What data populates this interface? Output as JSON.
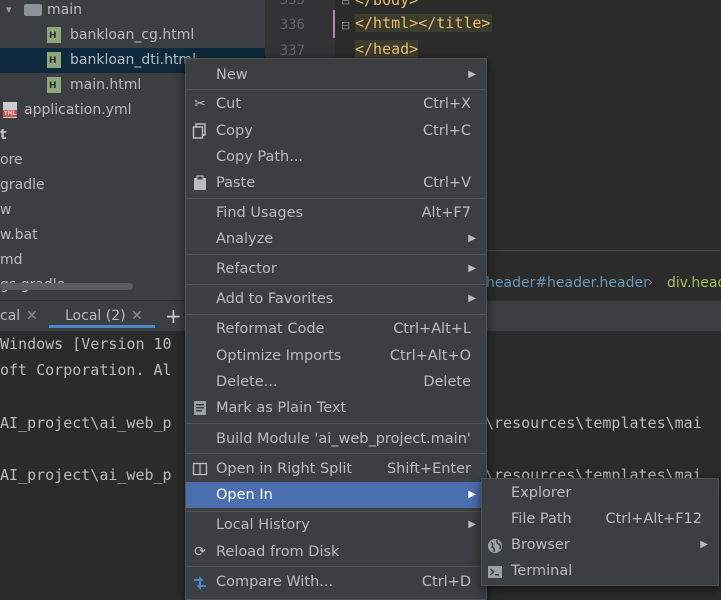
{
  "tree": {
    "items": [
      {
        "label": "main",
        "type": "folder"
      },
      {
        "label": "bankloan_cg.html",
        "type": "html"
      },
      {
        "label": "bankloan_dti.html",
        "type": "html",
        "selected": true
      },
      {
        "label": "main.html",
        "type": "html"
      },
      {
        "label": "application.yml",
        "type": "yml"
      },
      {
        "label": "t"
      },
      {
        "label": "ore"
      },
      {
        "label": "gradle"
      },
      {
        "label": "w"
      },
      {
        "label": "w.bat"
      },
      {
        "label": "md"
      },
      {
        "label": "gs.gradle"
      }
    ]
  },
  "editor": {
    "line_numbers": [
      "335",
      "336",
      "337"
    ],
    "lines": [
      "</body>",
      "</html></title>",
      "</head>"
    ],
    "breadcrumb": [
      "header#header.header",
      "div.head"
    ]
  },
  "terminal": {
    "tabs": [
      "cal",
      "Local (2)"
    ],
    "add_label": "+",
    "lines": [
      "Windows [Version 10",
      "oft Corporation. Al",
      "",
      "AI_project\\ai_web_p",
      "",
      "AI_project\\ai_web_p"
    ],
    "right_lines": [
      "\\resources\\templates\\mai",
      "\\resources\\templates\\mai"
    ]
  },
  "context_menu": {
    "items": [
      {
        "label": "New",
        "shortcut": "",
        "submenu": true,
        "icon": ""
      },
      {
        "label": "Cut",
        "shortcut": "Ctrl+X",
        "icon": "scissors-icon"
      },
      {
        "label": "Copy",
        "shortcut": "Ctrl+C",
        "icon": "copy-icon"
      },
      {
        "label": "Copy Path...",
        "shortcut": "",
        "icon": ""
      },
      {
        "label": "Paste",
        "shortcut": "Ctrl+V",
        "icon": "paste-icon"
      },
      {
        "label": "Find Usages",
        "shortcut": "Alt+F7",
        "icon": ""
      },
      {
        "label": "Analyze",
        "shortcut": "",
        "submenu": true,
        "icon": ""
      },
      {
        "label": "Refactor",
        "shortcut": "",
        "submenu": true,
        "icon": ""
      },
      {
        "label": "Add to Favorites",
        "shortcut": "",
        "submenu": true,
        "icon": ""
      },
      {
        "label": "Reformat Code",
        "shortcut": "Ctrl+Alt+L",
        "icon": ""
      },
      {
        "label": "Optimize Imports",
        "shortcut": "Ctrl+Alt+O",
        "icon": ""
      },
      {
        "label": "Delete...",
        "shortcut": "Delete",
        "icon": ""
      },
      {
        "label": "Mark as Plain Text",
        "shortcut": "",
        "icon": "plain-text-icon"
      },
      {
        "label": "Build Module 'ai_web_project.main'",
        "shortcut": "",
        "icon": ""
      },
      {
        "label": "Open in Right Split",
        "shortcut": "Shift+Enter",
        "icon": "split-icon"
      },
      {
        "label": "Open In",
        "shortcut": "",
        "submenu": true,
        "icon": "",
        "hover": true
      },
      {
        "label": "Local History",
        "shortcut": "",
        "submenu": true,
        "icon": ""
      },
      {
        "label": "Reload from Disk",
        "shortcut": "",
        "icon": "reload-icon"
      },
      {
        "label": "Compare With...",
        "shortcut": "Ctrl+D",
        "icon": "compare-icon"
      }
    ]
  },
  "open_in_submenu": {
    "items": [
      {
        "label": "Explorer",
        "shortcut": "",
        "icon": ""
      },
      {
        "label": "File Path",
        "shortcut": "Ctrl+Alt+F12",
        "icon": ""
      },
      {
        "label": "Browser",
        "shortcut": "",
        "submenu": true,
        "icon": "globe-icon"
      },
      {
        "label": "Terminal",
        "shortcut": "",
        "icon": "terminal-icon"
      }
    ]
  },
  "colors": {
    "menu_bg": "#3c3f41",
    "hover": "#4b6eaf",
    "tree_selection": "#0d293e",
    "tag": "#e8bf6a",
    "tab_underline": "#4a88c7"
  }
}
